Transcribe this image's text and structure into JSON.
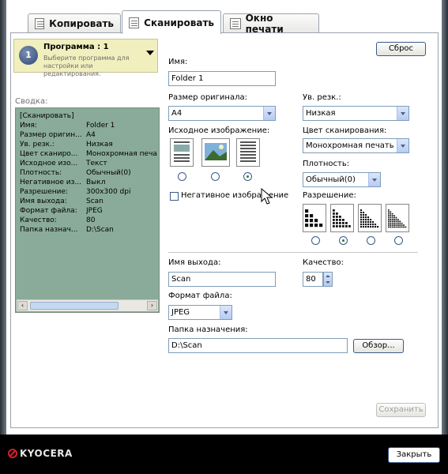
{
  "tabs": [
    {
      "label": "Копировать",
      "active": false
    },
    {
      "label": "Сканировать",
      "active": true
    },
    {
      "label": "Окно печати",
      "active": false
    }
  ],
  "program": {
    "number": "1",
    "title": "Программа : 1",
    "description": "Выберите программа для настройки или редактирования."
  },
  "reset_label": "Сброс",
  "summary": {
    "label": "Сводка:",
    "header": "[Сканировать]",
    "rows": [
      {
        "k": "Имя:",
        "v": "Folder 1"
      },
      {
        "k": "Размер оригин...",
        "v": "A4"
      },
      {
        "k": "Ув. резк.:",
        "v": "Низкая"
      },
      {
        "k": "Цвет сканиро...",
        "v": "Монохромная печат"
      },
      {
        "k": "Исходное изо...",
        "v": "Текст"
      },
      {
        "k": "Плотность:",
        "v": "Обычный(0)"
      },
      {
        "k": "Негативное из...",
        "v": "Выкл"
      },
      {
        "k": "Разрешение:",
        "v": "300x300 dpi"
      },
      {
        "k": "Имя выхода:",
        "v": "Scan"
      },
      {
        "k": "Формат файла:",
        "v": "JPEG"
      },
      {
        "k": "Качество:",
        "v": "80"
      },
      {
        "k": "Папка назнач...",
        "v": "D:\\Scan"
      }
    ]
  },
  "fields": {
    "name_label": "Имя:",
    "name_value": "Folder 1",
    "orig_size_label": "Размер оригинала:",
    "orig_size_value": "A4",
    "sharpness_label": "Ув. резк.:",
    "sharpness_value": "Низкая",
    "source_image_label": "Исходное изображение:",
    "scan_color_label": "Цвет сканирования:",
    "scan_color_value": "Монохромная печать",
    "density_label": "Плотность:",
    "density_value": "Обычный(0)",
    "negative_label": "Негативное изображение",
    "resolution_label": "Разрешение:",
    "output_name_label": "Имя выхода:",
    "output_name_value": "Scan",
    "quality_label": "Качество:",
    "quality_value": "80",
    "file_format_label": "Формат файла:",
    "file_format_value": "JPEG",
    "dest_folder_label": "Папка назначения:",
    "dest_folder_value": "D:\\Scan",
    "browse_label": "Обзор...",
    "save_label": "Сохранить"
  },
  "source_image_selected": 2,
  "resolution_selected": 1,
  "footer": {
    "brand": "KYOCERA",
    "close_label": "Закрыть"
  }
}
